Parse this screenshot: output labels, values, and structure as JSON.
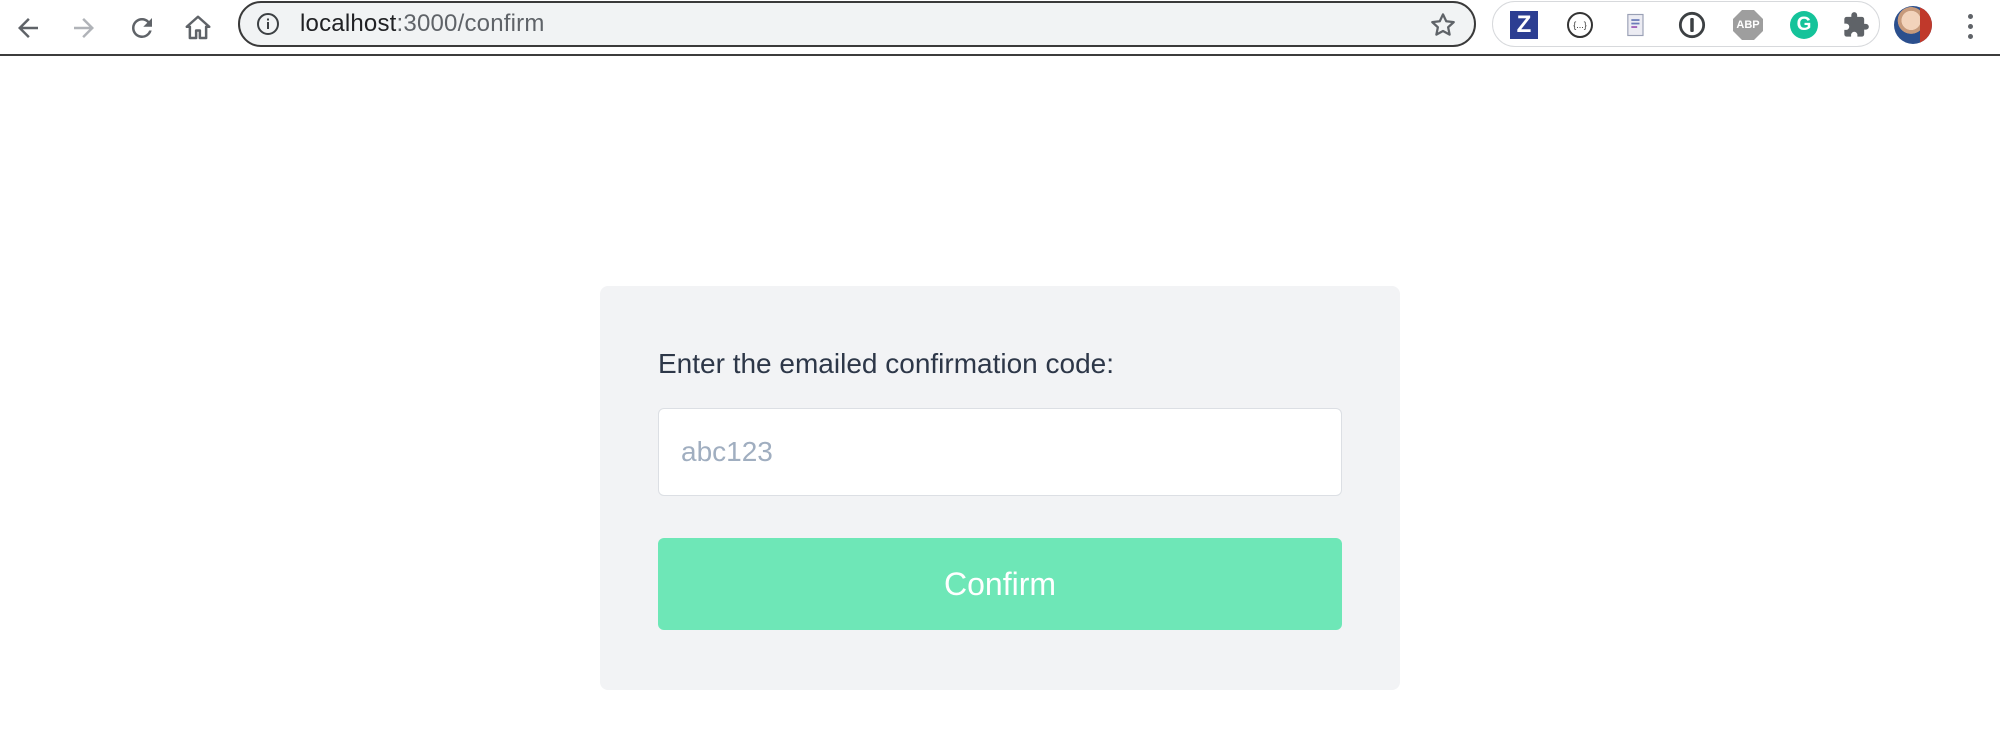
{
  "browser": {
    "url_host": "localhost",
    "url_path": ":3000/confirm",
    "icons": {
      "back": "arrow-left-icon",
      "forward": "arrow-right-icon",
      "reload": "reload-icon",
      "home": "home-icon",
      "info": "info-circle-icon",
      "bookmark": "star-icon",
      "menu": "three-dots-vertical-icon"
    },
    "extensions": [
      {
        "name": "zotero-extension",
        "glyph": "Z"
      },
      {
        "name": "json-viewer-extension",
        "glyph": "{...}"
      },
      {
        "name": "document-extension",
        "glyph": ""
      },
      {
        "name": "1password-extension",
        "glyph": ""
      },
      {
        "name": "adblock-plus-extension",
        "glyph": "ABP"
      },
      {
        "name": "grammarly-extension",
        "glyph": "G"
      },
      {
        "name": "extensions-puzzle",
        "glyph": ""
      }
    ]
  },
  "confirm_form": {
    "prompt": "Enter the emailed confirmation code:",
    "code_value": "",
    "code_placeholder": "abc123",
    "submit_label": "Confirm"
  },
  "colors": {
    "button": "#6ee7b7",
    "card": "#f2f3f5",
    "text": "#2d3748",
    "placeholder": "#a0aec0"
  }
}
